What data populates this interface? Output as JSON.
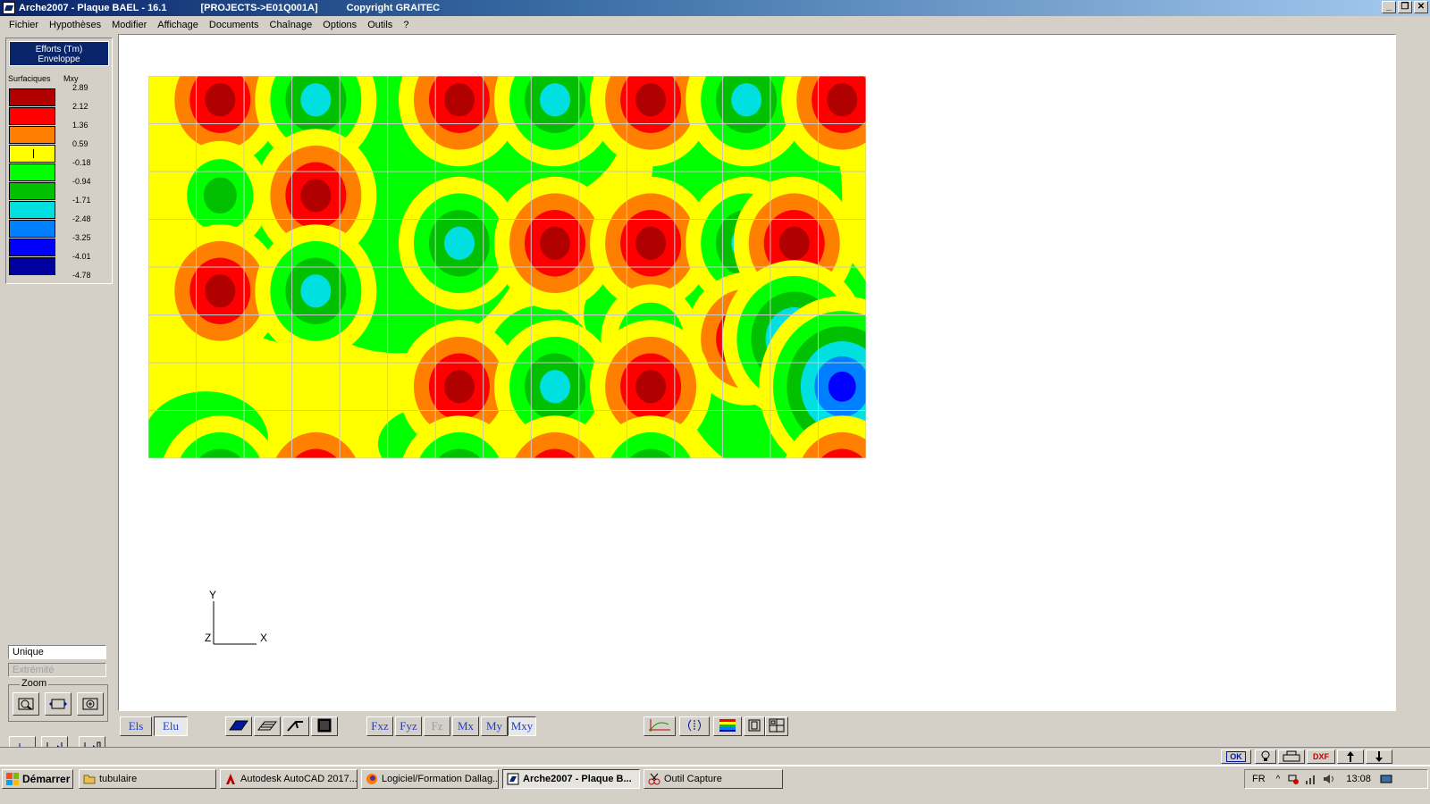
{
  "window": {
    "title": "Arche2007 - Plaque BAEL - 16.1",
    "project": "[PROJECTS->E01Q001A]",
    "copyright": "Copyright GRAITEC"
  },
  "menu": [
    "Fichier",
    "Hypothèses",
    "Modifier",
    "Affichage",
    "Documents",
    "Chaînage",
    "Options",
    "Outils",
    "?"
  ],
  "legend": {
    "header_line1": "Efforts (Tm)",
    "header_line2": "Enveloppe",
    "sub_left": "Surfaciques",
    "sub_right": "Mxy",
    "values": [
      "2.89",
      "2.12",
      "1.36",
      "0.59",
      "-0.18",
      "-0.94",
      "-1.71",
      "-2.48",
      "-3.25",
      "-4.01",
      "-4.78"
    ],
    "colors": [
      "#b00000",
      "#ff0000",
      "#ff8000",
      "#ffff00",
      "#00ff00",
      "#00c000",
      "#00e0e0",
      "#0080ff",
      "#0000ff",
      "#0000a0"
    ]
  },
  "side": {
    "mode_value": "Unique",
    "mode2_value": "Extrémité",
    "zoom_label": "Zoom"
  },
  "axes": {
    "y": "Y",
    "z": "Z",
    "x": "X"
  },
  "bottom_buttons": {
    "els": "Els",
    "elu": "Elu",
    "fxz": "Fxz",
    "fyz": "Fyz",
    "fz": "Fz",
    "mx": "Mx",
    "my": "My",
    "mxy": "Mxy"
  },
  "status": {
    "ok": "OK",
    "dxf": "DXF"
  },
  "taskbar": {
    "start": "Démarrer",
    "tasks": [
      "tubulaire",
      "Autodesk AutoCAD 2017...",
      "Logiciel/Formation Dallag...",
      "Arche2007 - Plaque B...",
      "Outil Capture"
    ],
    "lang": "FR",
    "time": "13:08"
  },
  "chart_data": {
    "type": "heatmap",
    "title": "Efforts (Tm) Enveloppe",
    "quantity": "Mxy",
    "legend_levels": [
      2.89,
      2.12,
      1.36,
      0.59,
      -0.18,
      -0.94,
      -1.71,
      -2.48,
      -3.25,
      -4.01,
      -4.78
    ],
    "grid": true,
    "grid_columns": 15,
    "grid_rows": 8,
    "extrema": [
      {
        "col": 1,
        "row": 0,
        "value": 2.12
      },
      {
        "col": 3,
        "row": 0,
        "value": -2.48
      },
      {
        "col": 6,
        "row": 0,
        "value": 2.12
      },
      {
        "col": 8,
        "row": 0,
        "value": -2.48
      },
      {
        "col": 10,
        "row": 0,
        "value": 2.12
      },
      {
        "col": 12,
        "row": 0,
        "value": -2.48
      },
      {
        "col": 14,
        "row": 0,
        "value": 2.12
      },
      {
        "col": 1,
        "row": 2,
        "value": -1.71
      },
      {
        "col": 3,
        "row": 2,
        "value": 2.12
      },
      {
        "col": 6,
        "row": 3,
        "value": -2.48
      },
      {
        "col": 8,
        "row": 3,
        "value": 2.89
      },
      {
        "col": 10,
        "row": 3,
        "value": 2.12
      },
      {
        "col": 12,
        "row": 3,
        "value": -2.48
      },
      {
        "col": 13,
        "row": 3,
        "value": 2.12
      },
      {
        "col": 1,
        "row": 4,
        "value": 2.12
      },
      {
        "col": 3,
        "row": 4,
        "value": -2.48
      },
      {
        "col": 10,
        "row": 5,
        "value": -1.71
      },
      {
        "col": 12,
        "row": 5,
        "value": 2.12
      },
      {
        "col": 13,
        "row": 5,
        "value": -3.25
      },
      {
        "col": 14,
        "row": 6,
        "value": -4.01
      },
      {
        "col": 6,
        "row": 6,
        "value": 2.89
      },
      {
        "col": 8,
        "row": 6,
        "value": -2.48
      },
      {
        "col": 10,
        "row": 6,
        "value": 2.12
      },
      {
        "col": 1,
        "row": 8,
        "value": -2.48
      },
      {
        "col": 3,
        "row": 8,
        "value": 2.89
      },
      {
        "col": 6,
        "row": 8,
        "value": -2.48
      },
      {
        "col": 8,
        "row": 8,
        "value": 2.12
      },
      {
        "col": 10,
        "row": 8,
        "value": -2.48
      },
      {
        "col": 14,
        "row": 8,
        "value": 2.12
      }
    ]
  }
}
